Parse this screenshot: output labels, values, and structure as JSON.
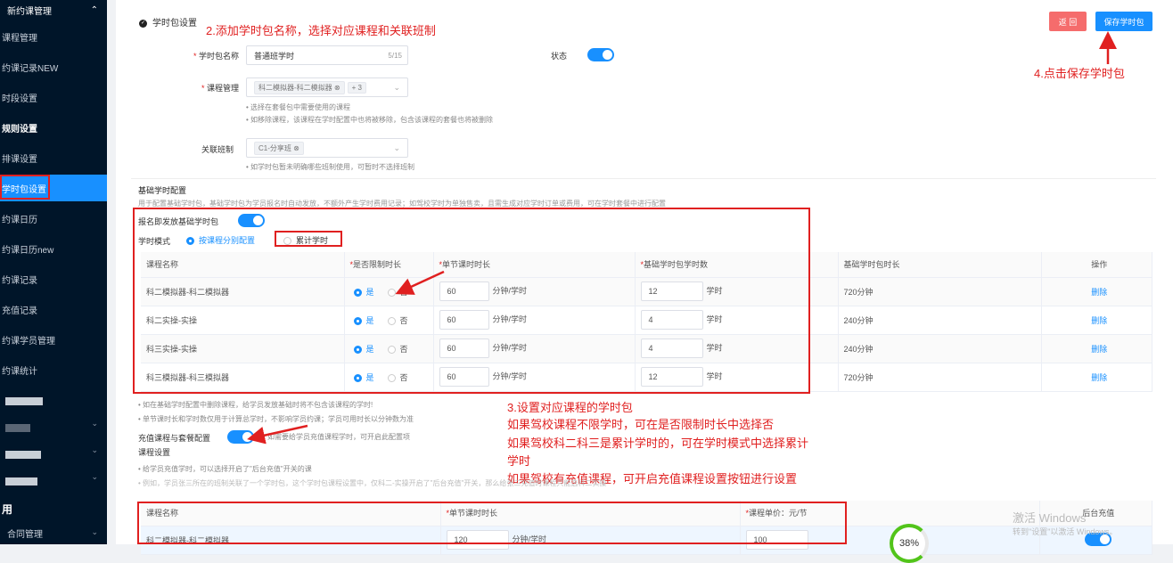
{
  "sidebar": {
    "header": "新约课管理",
    "items": [
      {
        "label": "课程管理"
      },
      {
        "label": "约课记录NEW"
      },
      {
        "label": "时段设置"
      },
      {
        "label": "规则设置"
      },
      {
        "label": "排课设置"
      },
      {
        "label": "学时包设置"
      },
      {
        "label": "约课日历"
      },
      {
        "label": "约课日历new"
      },
      {
        "label": "约课记录"
      },
      {
        "label": "充值记录"
      },
      {
        "label": "约课学员管理"
      },
      {
        "label": "约课统计"
      }
    ],
    "group_label": "用",
    "bottom_item": "合同管理"
  },
  "header": {
    "title": "学时包设置",
    "back_button": "返 回",
    "save_button": "保存学时包"
  },
  "form": {
    "name_label": "学时包名称",
    "name_value": "普通班学时",
    "name_count": "5/15",
    "status_label": "状态",
    "course_label": "课程管理",
    "course_tag": "科二模拟器-科二模拟器",
    "course_more": "+ 3",
    "course_hint1": "• 选择在套餐包中需要使用的课程",
    "course_hint2": "• 如移除课程，该课程在学时配置中也将被移除，包含该课程的套餐也将被删除",
    "class_label": "关联班制",
    "class_tag": "C1-分享班",
    "class_hint": "• 如学时包暂未明确哪些班制使用，可暂时不选择班制"
  },
  "basic": {
    "title": "基础学时配置",
    "desc": "用于配置基础学时包，基础学时包为学员报名时自动发放，不额外产生学时费用记录；如驾校学时为单独售卖，且需生成对应学时订单或费用，可在学时套餐中进行配置",
    "issue_label": "报名即发放基础学时包",
    "mode_label": "学时模式",
    "mode_opt1": "按课程分别配置",
    "mode_opt2": "累计学时",
    "headers": [
      "课程名称",
      "是否限制时长",
      "单节课时时长",
      "基础学时包学时数",
      "基础学时包时长",
      "操作"
    ],
    "yes": "是",
    "no": "否",
    "min_unit": "分钟/学时",
    "hour_unit": "学时",
    "delete": "删除",
    "rows": [
      {
        "name": "科二模拟器-科二模拟器",
        "minutes": "60",
        "hours": "12",
        "total": "720分钟"
      },
      {
        "name": "科二实操-实操",
        "minutes": "60",
        "hours": "4",
        "total": "240分钟"
      },
      {
        "name": "科三实操-实操",
        "minutes": "60",
        "hours": "4",
        "total": "240分钟"
      },
      {
        "name": "科三模拟器-科三模拟器",
        "minutes": "60",
        "hours": "12",
        "total": "720分钟"
      }
    ],
    "note1": "• 如在基础学时配置中删除课程，给学员发放基础时将不包含该课程的学时!",
    "note2": "• 单节课时长和学时数仅用于计算总学时，不影响学员约课；学员可用时长以分钟数为准"
  },
  "recharge": {
    "label": "充值课程与套餐配置",
    "label_tail": "如需要给学员充值课程学时，可开启此配置项",
    "course_setting": "课程设置",
    "hint1": "• 给学员充值学时，可以选择开启了\"后台充值\"开关的课",
    "hint2": "• 例如，学员张三所在的班制关联了一个学时包，这个学时包课程设置中，仅科二-实操开启了\"后台充值\"开关，那么给张三充值时课程只能选科二实操",
    "headers": [
      "课程名称",
      "单节课时时长",
      "课程单价：元/节",
      "后台充值"
    ],
    "row": {
      "name": "科二模拟器-科二模拟器",
      "minutes": "120",
      "unit": "分钟/学时",
      "price": "100"
    },
    "progress": "38%"
  },
  "annotations": {
    "note2": "2.添加学时包名称，选择对应课程和关联班制",
    "note3_line1": "3.设置对应课程的学时包",
    "note3_line2": "如果驾校课程不限学时，可在是否限制时长中选择否",
    "note3_line3": "如果驾校科二科三是累计学时的，可在学时模式中选择累计",
    "note3_line4": "学时",
    "note3_line5": "如果驾校有充值课程，可开启充值课程设置按钮进行设置",
    "note4": "4.点击保存学时包"
  },
  "watermark": {
    "line1": "激活 Windows",
    "line2": "转到\"设置\"以激活 Windows。"
  },
  "colors": {
    "accent": "#1890ff",
    "annotation_red": "#e02020",
    "sidebar_bg": "#001529",
    "back_button": "#f56c6c"
  }
}
